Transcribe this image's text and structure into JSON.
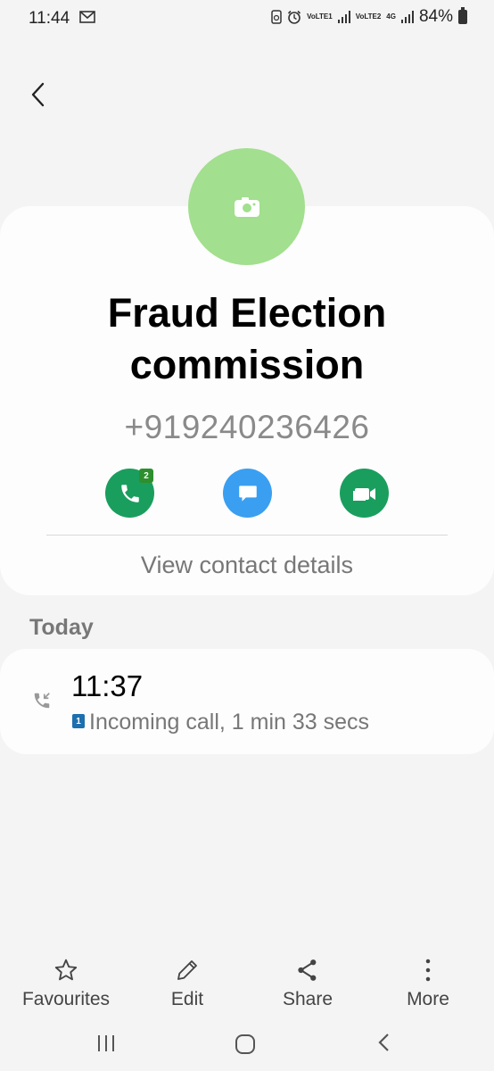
{
  "status_bar": {
    "time": "11:44",
    "battery": "84%",
    "sim1_label": "VoLTE1",
    "sim2_label": "VoLTE2",
    "network": "4G",
    "icons": [
      "message-icon",
      "sync-icon",
      "alarm-icon",
      "signal-icon",
      "battery-icon"
    ]
  },
  "contact": {
    "name": "Fraud Election commission",
    "number": "+919240236426",
    "call_badge": "2",
    "view_details_label": "View contact details"
  },
  "history": {
    "section_label": "Today",
    "entries": [
      {
        "time": "11:37",
        "sim": "1",
        "detail": "Incoming call, 1 min 33 secs"
      }
    ]
  },
  "toolbar": {
    "favourites_label": "Favourites",
    "edit_label": "Edit",
    "share_label": "Share",
    "more_label": "More"
  },
  "colors": {
    "avatar": "#a2df8e",
    "call": "#1a9e5e",
    "message": "#3a9ff1",
    "video": "#1a9e5e"
  }
}
